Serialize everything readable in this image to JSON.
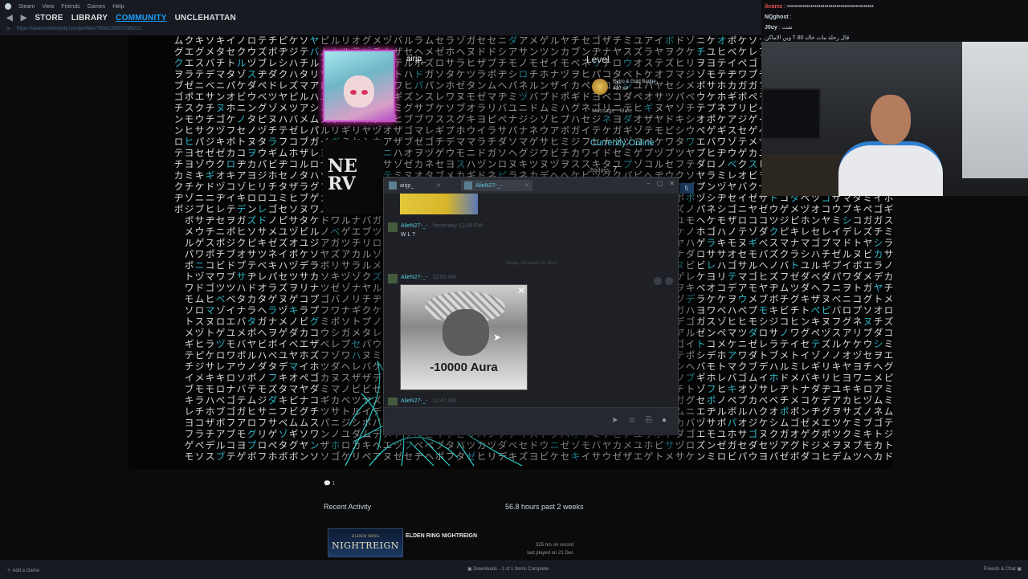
{
  "steam_menu": [
    "Steam",
    "View",
    "Friends",
    "Games",
    "Help"
  ],
  "nav": {
    "store": "STORE",
    "library": "LIBRARY",
    "community": "COMMUNITY",
    "user": "UNCLEHATTAN"
  },
  "url": "https://steamcommunity.com/profiles/76561199003785222",
  "profile": {
    "name": "airjp_",
    "level_label": "Level",
    "badge_line1": "Retro & Gold Badge",
    "badge_line2": "400 XP",
    "messages_label": "Message · Mute",
    "status": "Currently Online",
    "badges_label": "Badges",
    "badges_count": "7",
    "count_box": "5",
    "comment_count": "1",
    "recent_activity": "Recent Activity",
    "hours_past": "56.8 hours past 2 weeks",
    "game": {
      "cap_top": "ELDEN RING",
      "cap_main": "NIGHTREIGN",
      "name": "ELDEN RING NIGHTREIGN",
      "hours": "325 hrs on record",
      "last_played": "last played on 21 Dec"
    }
  },
  "chat": {
    "tab1": "airjp_",
    "tab2": "AlieN27-_-",
    "messages": [
      {
        "name": "AlieN27-_-",
        "time": "Yesterday 11:28 PM",
        "text": "W L ?"
      },
      {
        "name": "AlieN27-_-",
        "time": "12:00 AM",
        "text": ""
      },
      {
        "name": "AlieN27-_-",
        "time": "12:47 AM",
        "text": "؟،"
      }
    ],
    "divider": "Sunday, December 22, 2024",
    "meme_caption": "-10000 Aura"
  },
  "bottombar": {
    "add_game": "Add a Game",
    "downloads": "Downloads - 1 of 1 Items Complete",
    "friends": "Friends & Chat"
  },
  "stream_chat": [
    {
      "user": "ikramz",
      "text": ": ••••••••••••••••••••••••••••••••••••••••••••",
      "color": "#e05252"
    },
    {
      "user": "NQghost",
      "text": ":",
      "color": "#f0f0f0"
    },
    {
      "user": "J0uy",
      "text": ": شت",
      "color": "#f0f0f0"
    },
    {
      "user": "",
      "text": "قال رحلة مات خالد 80 ؟ وين الاماكن",
      "color": "#f0f0f0"
    }
  ],
  "matrix_chars": "アイウエオカキクケコサシスセソタチツテトナニヌネノハヒフヘホマミムメモヤユヨラリルレロワヲンガギグゲゴザジズゼゾダヂヅデドバビブベボパピプペポ"
}
